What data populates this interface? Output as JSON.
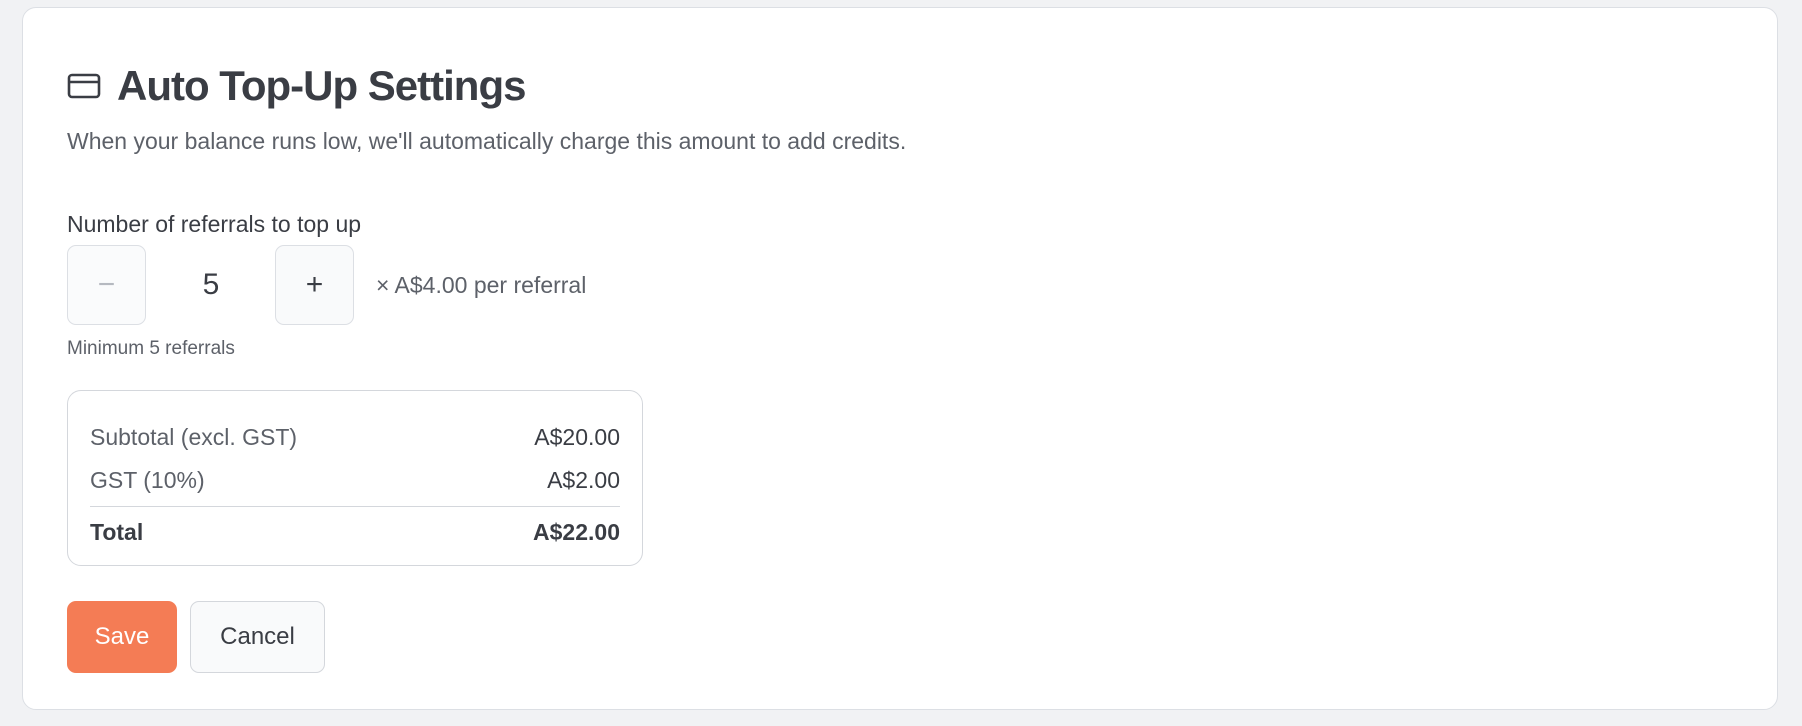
{
  "header": {
    "icon": "credit-card-icon",
    "title": "Auto Top-Up Settings",
    "subtitle": "When your balance runs low, we'll automatically charge this amount to add credits."
  },
  "referrals": {
    "label": "Number of referrals to top up",
    "decrement_symbol": "−",
    "increment_symbol": "+",
    "value": "5",
    "unit_price_text": "× A$4.00 per referral",
    "hint": "Minimum 5 referrals"
  },
  "summary": {
    "subtotal_label": "Subtotal (excl. GST)",
    "subtotal_value": "A$20.00",
    "gst_label": "GST (10%)",
    "gst_value": "A$2.00",
    "total_label": "Total",
    "total_value": "A$22.00"
  },
  "actions": {
    "save_label": "Save",
    "cancel_label": "Cancel"
  },
  "colors": {
    "accent": "#f47c55",
    "background": "#f1f2f4",
    "card": "#ffffff",
    "text": "#3a3d44",
    "muted": "#5d6169"
  }
}
